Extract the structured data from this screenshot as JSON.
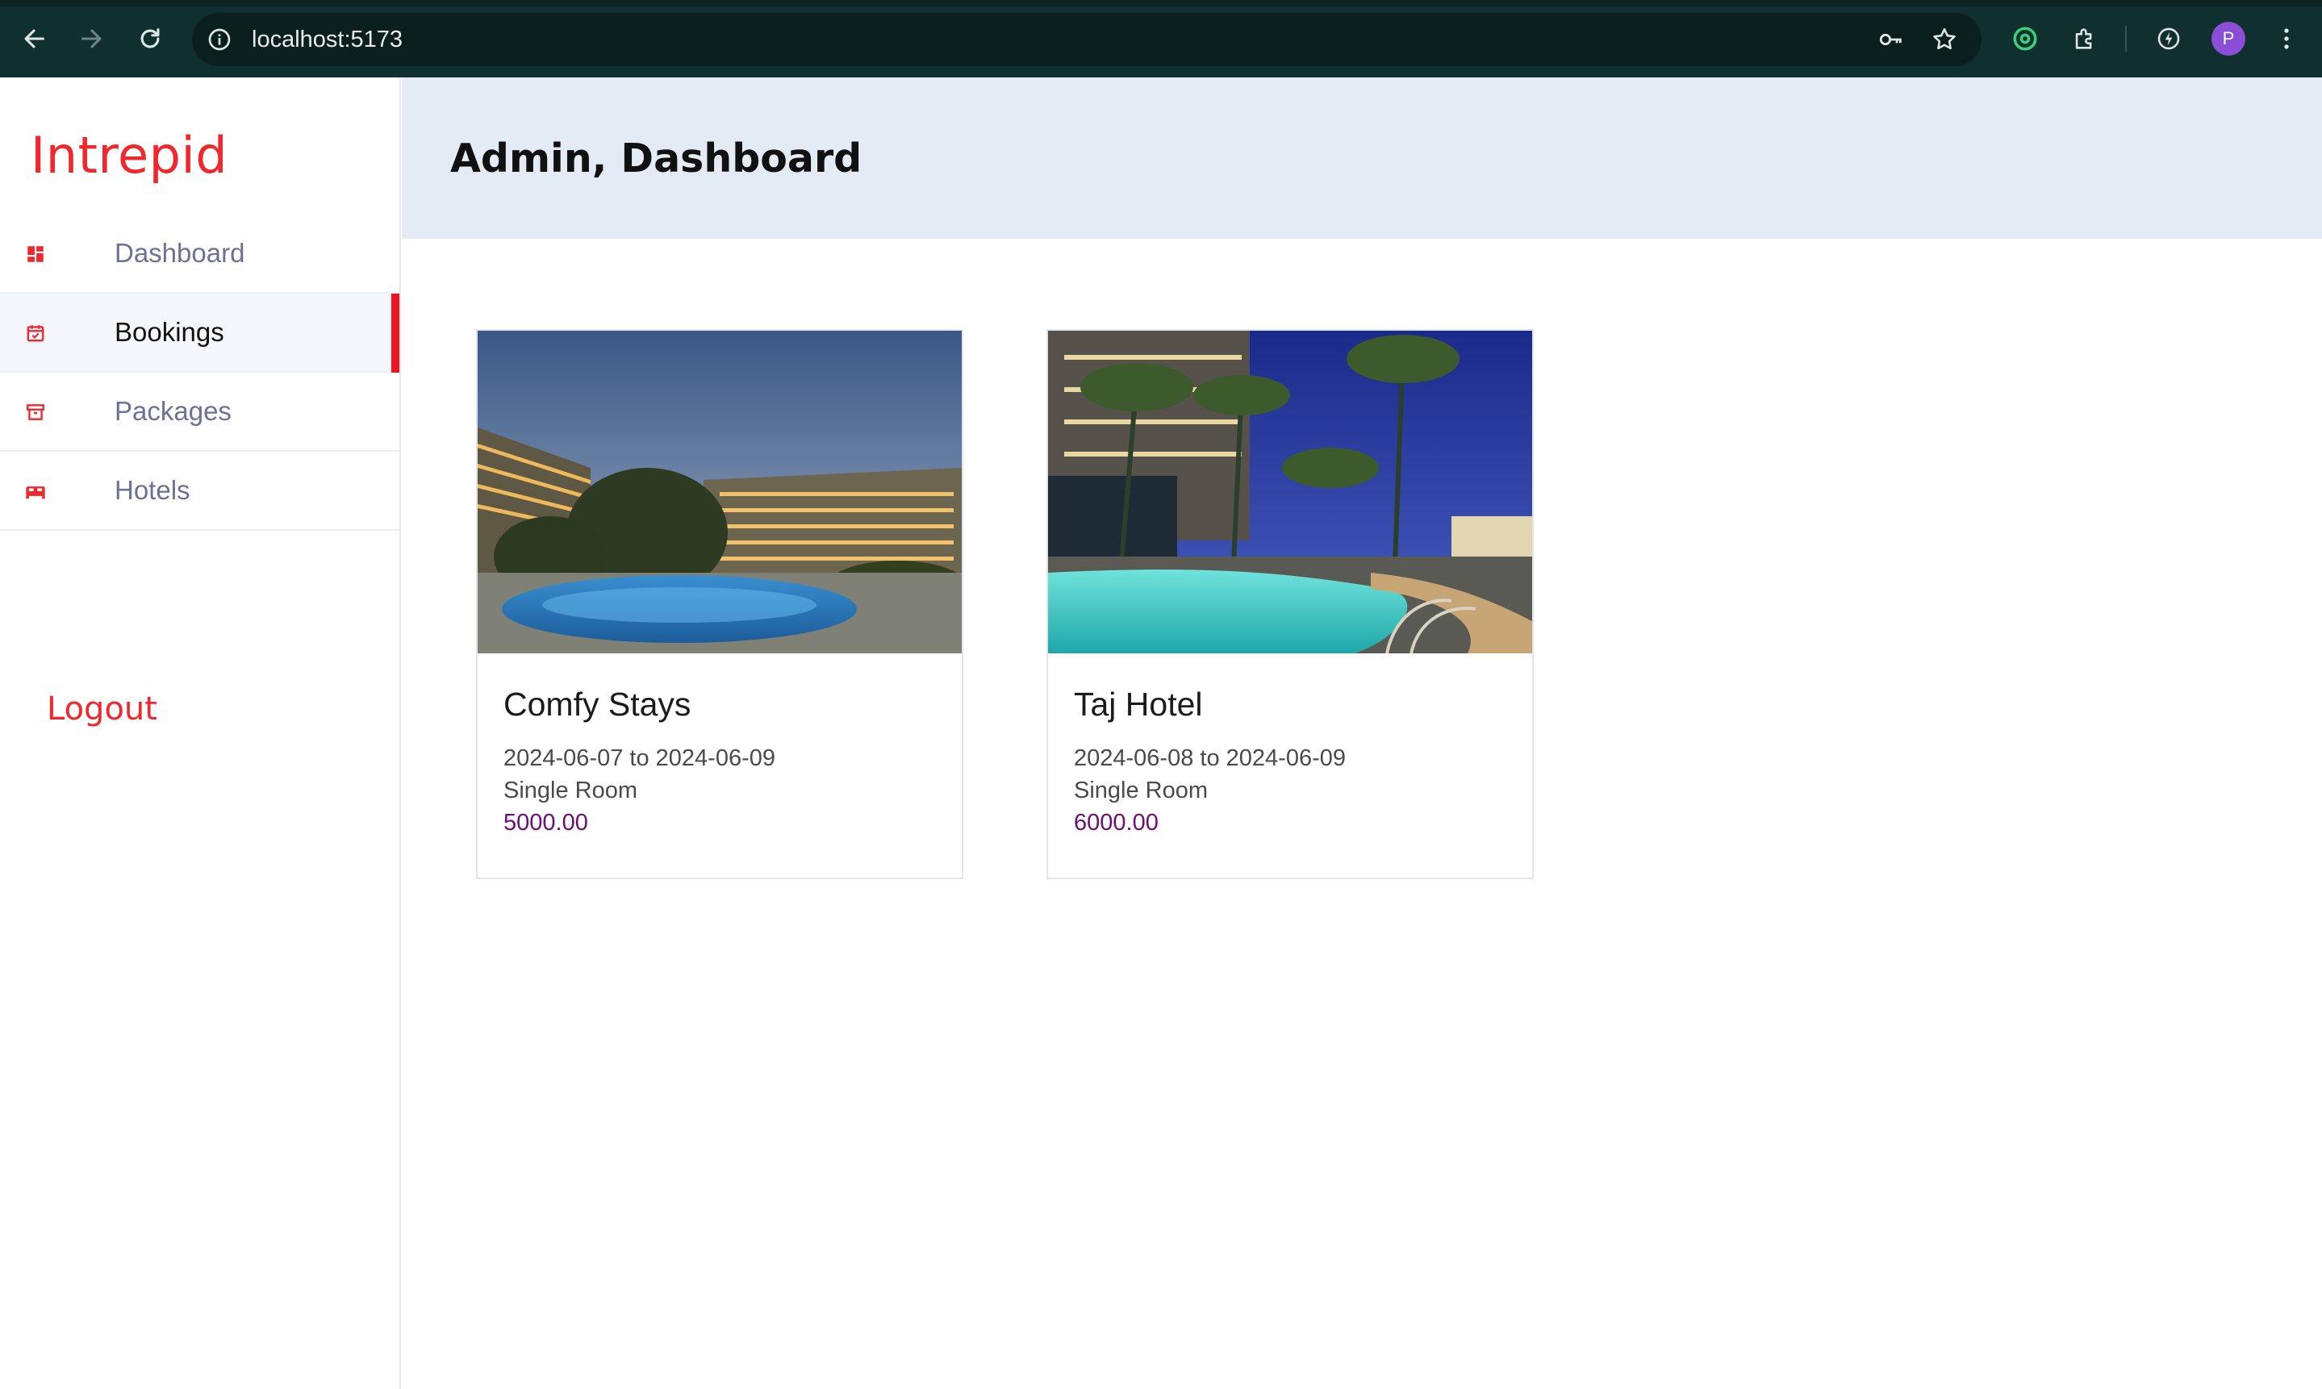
{
  "browser": {
    "url": "localhost:5173",
    "profile_initial": "P",
    "icons": [
      "back-arrow-icon",
      "forward-arrow-icon",
      "reload-icon",
      "site-info-icon",
      "password-key-icon",
      "bookmark-star-icon",
      "extension-green-icon",
      "extensions-puzzle-icon",
      "performance-icon",
      "kebab-menu-icon"
    ]
  },
  "sidebar": {
    "brand": "Intrepid",
    "items": [
      {
        "label": "Dashboard",
        "icon": "dashboard-icon",
        "active": false
      },
      {
        "label": "Bookings",
        "icon": "calendar-check-icon",
        "active": true
      },
      {
        "label": "Packages",
        "icon": "archive-box-icon",
        "active": false
      },
      {
        "label": "Hotels",
        "icon": "bed-icon",
        "active": false
      }
    ],
    "logout": "Logout"
  },
  "header": {
    "title": "Admin, Dashboard"
  },
  "bookings": [
    {
      "hotel": "Comfy Stays",
      "dates": "2024-06-07 to 2024-06-09",
      "room": "Single Room",
      "price": "5000.00"
    },
    {
      "hotel": "Taj Hotel",
      "dates": "2024-06-08 to 2024-06-09",
      "room": "Single Room",
      "price": "6000.00"
    }
  ],
  "colors": {
    "brand": "#f0282d",
    "active_indicator": "#f0141e",
    "price": "#6e0c78",
    "header_bg": "#e5ebf5",
    "chrome_bg": "#10302f"
  }
}
